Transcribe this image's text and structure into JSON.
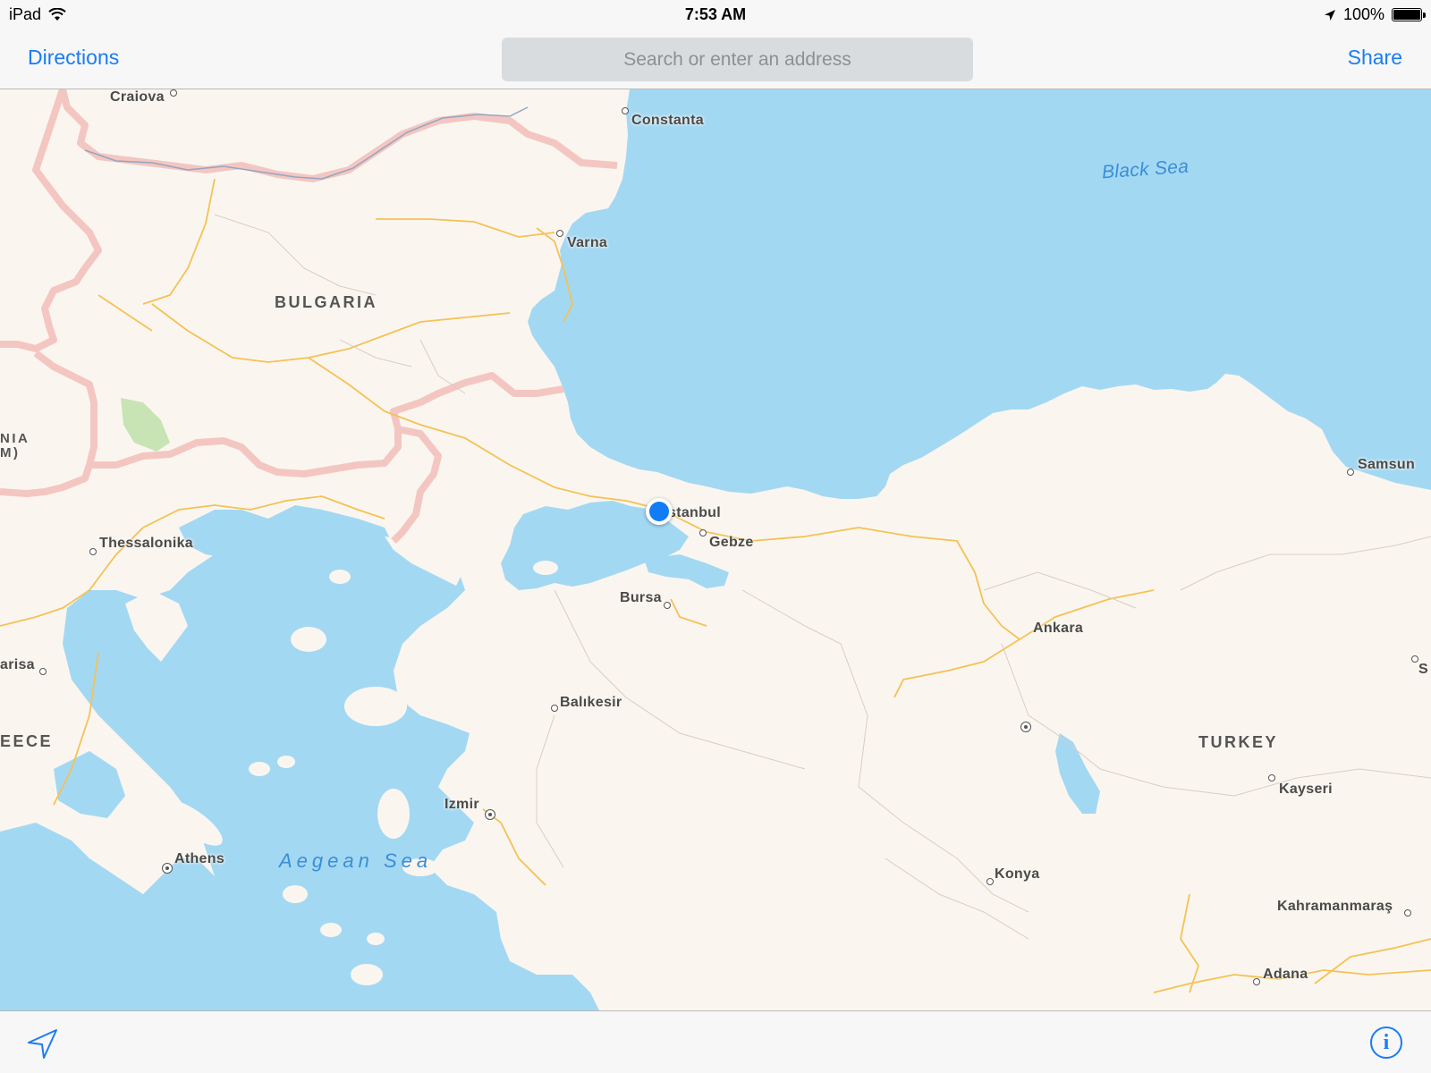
{
  "status_bar": {
    "device": "iPad",
    "time": "7:53 AM",
    "battery_text": "100%",
    "battery_level_percent": 100
  },
  "nav": {
    "directions_label": "Directions",
    "search_placeholder": "Search or enter an address",
    "share_label": "Share"
  },
  "map": {
    "water_color": "#a3d8f3",
    "land_color": "#faf6ef",
    "border_color": "#f4c6c2",
    "road_color": "#f5c155",
    "user_location_color": "#127cf5",
    "countries": [
      "BULGARIA",
      "TURKEY",
      "NIA",
      "M)",
      "EECE"
    ],
    "seas": [
      "Black Sea",
      "Aegean Sea"
    ],
    "cities": [
      "Craiova",
      "Constanta",
      "Varna",
      "stanbul",
      "Gebze",
      "Thessalonika",
      "Bursa",
      "Ankara",
      "Samsun",
      "arisa",
      "Balıkesir",
      "Kayseri",
      "Izmir",
      "Athens",
      "Konya",
      "Kahramanmaraş",
      "Adana",
      "S"
    ]
  },
  "toolbar": {
    "location_icon": "location-arrow-icon",
    "info_icon": "info-icon",
    "info_glyph": "i"
  }
}
